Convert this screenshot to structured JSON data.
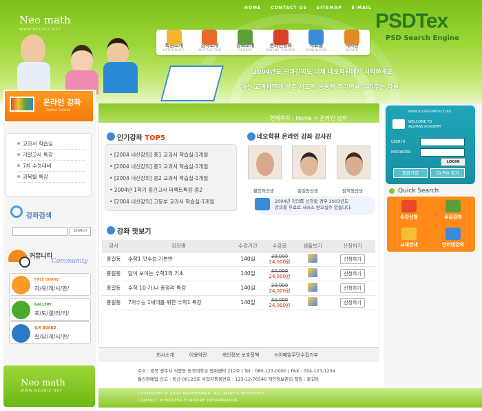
{
  "header": {
    "top_nav": [
      "HOME",
      "CONTACT US",
      "SITEMAP",
      "E-MAIL"
    ],
    "logo": "Neo math",
    "logo_sub": "WWW.NEOBIZ.NET",
    "main_nav": [
      {
        "label": "학원소개",
        "en": "INTRODUCE",
        "color": "#f2b630"
      },
      {
        "label": "강사소개",
        "en": "INSTRUCTOR",
        "color": "#e86a2a"
      },
      {
        "label": "강좌소개",
        "en": "COURSE",
        "color": "#5aa03a"
      },
      {
        "label": "온라인강좌",
        "en": "ONLINE COURSE",
        "color": "#d8402a"
      },
      {
        "label": "자료실",
        "en": "DOWNLOAD",
        "color": "#3a8ad8"
      },
      {
        "label": "게시판",
        "en": "BOARD",
        "color": "#e08a2a"
      }
    ],
    "watermark": "PSDTex",
    "watermark_sub": "PSD Search Engine",
    "slogan_line1": "2004년도 단과강의도 이제 네오학원에서 시작하세요",
    "slogan_line2": "내신 교과과정에 맞춘 사고력 응용력 추리력을 길러주는 학원"
  },
  "sidebar": {
    "online_title": "온라인 강좌",
    "online_sub": "Online Course",
    "lectures": [
      "교과서 학습실",
      "기말고사 특강",
      "7차 수능대비",
      "과목별 특강"
    ],
    "search_title": "강좌검색",
    "search_button": "SEARCH",
    "community_title": "커뮤니티",
    "community_en": "Community",
    "boards": [
      {
        "en": "FREE BOARD",
        "ko": "자/유/게/시/판/",
        "en_color": "#ff8a1a",
        "icon_color": "#ff9a2a"
      },
      {
        "en": "GALLERY",
        "ko": "포/토/갤/러/리/",
        "en_color": "#3a9a2a",
        "icon_color": "#4aaa2a"
      },
      {
        "en": "Q/A BOARD",
        "ko": "질/답/게/시/판/",
        "en_color": "#e06a1a",
        "icon_color": "#2a7ac8"
      }
    ],
    "bottom_logo": "Neo math",
    "bottom_logo_sub": "WWW.NEOBIZ.NET"
  },
  "content": {
    "location": "현재위치 : Home > 온라인 강좌",
    "top5_title_a": "인기강좌 ",
    "top5_title_b": "TOP5",
    "top5": [
      "[2004 내신강의] 중1 교과서 학습실-1개월",
      "[2004 내신강의] 중1 교과서 학습실-1개월",
      "[2004 내신강의] 중2 교과서 학습실-1개월",
      "2004년 1학기 중간고사 퍼펙트특강-중2",
      "[2004 내신강의] 고등부 교과서 학습실-1개월"
    ],
    "teachers_title": "네오학원 온라인 강좌 강사진",
    "teachers": [
      "황진희선생",
      "홍길동선생",
      "임꺽정선생"
    ],
    "teacher_note": [
      "2004년 강의를 신청할 경우 2003년도",
      "강의를 무료로 서비스 받으실수 있습니다."
    ],
    "preview_title": "강좌 맛보기",
    "table_headers": [
      "강사",
      "강좌명",
      "수강기간",
      "수강료",
      "샘플보기",
      "신청하기"
    ],
    "rows": [
      {
        "teacher": "홍길동",
        "name": "수학1 맛수능 기본반",
        "period": "140일",
        "old": "30,000",
        "new": "24,000원",
        "apply": "신청하기"
      },
      {
        "teacher": "홍길동",
        "name": "답이 보이는 수학1의 기초",
        "period": "140일",
        "old": "30,000",
        "new": "24,000원",
        "apply": "신청하기"
      },
      {
        "teacher": "홍길동",
        "name": "수학 10-가,나 총정리 특강",
        "period": "140일",
        "old": "30,000",
        "new": "24,000원",
        "apply": "신청하기"
      },
      {
        "teacher": "홍길동",
        "name": "7차수능 1세대를 위한 수학1 특강",
        "period": "140일",
        "old": "30,000",
        "new": "24,000원",
        "apply": "신청하기"
      }
    ]
  },
  "footer": {
    "links": [
      "회사소개",
      "이용약관",
      "개인정보 보호정책",
      "이메일무단수집거부"
    ],
    "addr1": "주소 : 경북 경주시 석장동 동국대학교 벤처센터 212호 | Tel : 080-123-0000 | FAX : 054-123-1234",
    "addr2": "통신판매업 신고 : 동산 00123호  사업자등록번호 : 123-12-76540  개인정보관리 책임 : 홍길동",
    "copyright": "COPYRIGHT © 2004 MATHWORLD. ALL RIGHTS RESERVED.",
    "contact": "CONTACT ✉ MASTER FORMORE INFORMATION"
  },
  "login": {
    "site": "WWW.ALLPRESMATH.CO.KR",
    "welcome1": "WELCOME TO",
    "welcome2": "ALLPASS ACADEMY",
    "id_label": "USER ID",
    "pw_label": "PASSWORD",
    "login_button": "LOGIN",
    "join_button": "회원가입",
    "find_button": "ID,PW 찾기"
  },
  "quick_search": {
    "title": "Quick Search",
    "items": [
      {
        "label": "수강신청",
        "color": "#e84a2a"
      },
      {
        "label": "무료강좌",
        "color": "#5aa03a"
      },
      {
        "label": "교재안내",
        "color": "#f2c030"
      },
      {
        "label": "인터넷강의",
        "color": "#3a8ad8"
      }
    ]
  }
}
